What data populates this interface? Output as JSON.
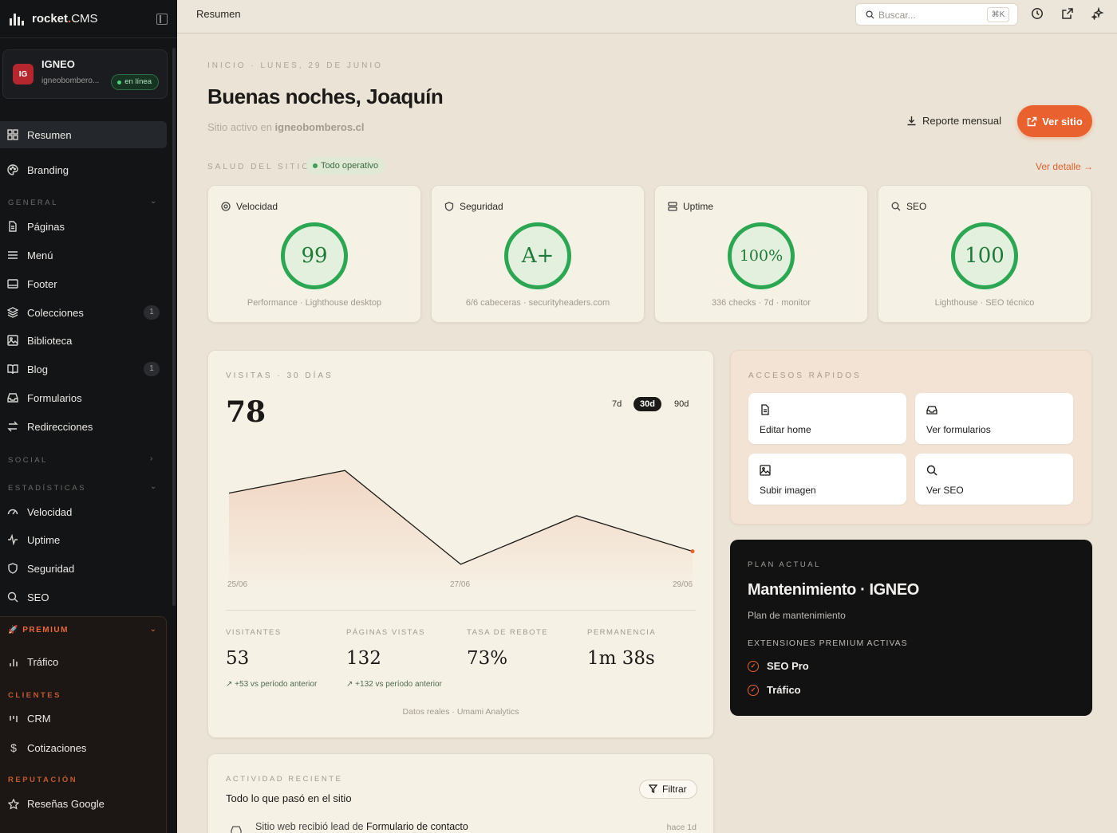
{
  "brand": {
    "name": "rocket",
    "dot": ".",
    "suffix": "CMS"
  },
  "site": {
    "initials": "IG",
    "name": "IGNEO",
    "domain": "igneobombero...",
    "status": "en línea"
  },
  "nav": {
    "summary": "Resumen",
    "branding": "Branding",
    "general_label": "GENERAL",
    "general": [
      {
        "label": "Páginas"
      },
      {
        "label": "Menú"
      },
      {
        "label": "Footer"
      },
      {
        "label": "Colecciones",
        "count": "1"
      },
      {
        "label": "Biblioteca"
      },
      {
        "label": "Blog",
        "count": "1"
      },
      {
        "label": "Formularios"
      },
      {
        "label": "Redirecciones"
      }
    ],
    "social_label": "SOCIAL",
    "stats_label": "ESTADÍSTICAS",
    "stats": [
      "Velocidad",
      "Uptime",
      "Seguridad",
      "SEO"
    ],
    "premium_label": "PREMIUM",
    "premium_item": "Tráfico",
    "clients_label": "CLIENTES",
    "clients": [
      "CRM",
      "Cotizaciones"
    ],
    "reputation_label": "REPUTACIÓN",
    "reputation": [
      "Reseñas Google"
    ]
  },
  "topbar": {
    "breadcrumb": "Resumen",
    "search_placeholder": "Buscar...",
    "shortcut": "⌘K"
  },
  "header": {
    "eyebrow": "INICIO · LUNES, 29 DE JUNIO",
    "greeting": "Buenas noches, Joaquín",
    "subtitle_prefix": "Sitio activo en ",
    "subtitle_domain": "igneobomberos.cl",
    "report_button": "Reporte mensual",
    "site_button": "Ver sitio"
  },
  "health": {
    "label": "SALUD DEL SITIO",
    "badge": "Todo operativo",
    "detail_link": "Ver detalle →",
    "cards": [
      {
        "title": "Velocidad",
        "value": "99",
        "sub": "Performance · Lighthouse desktop",
        "icon": "gauge-icon"
      },
      {
        "title": "Seguridad",
        "value": "A+",
        "sub": "6/6 cabeceras · securityheaders.com",
        "icon": "shield-icon"
      },
      {
        "title": "Uptime",
        "value": "100%",
        "sub": "336 checks · 7d · monitor",
        "icon": "server-icon"
      },
      {
        "title": "SEO",
        "value": "100",
        "sub": "Lighthouse · SEO técnico",
        "icon": "search-icon"
      }
    ]
  },
  "visits": {
    "label": "VISITAS · 30 DÍAS",
    "total": "78",
    "ranges": [
      "7d",
      "30d",
      "90d"
    ],
    "selected_range": "30d",
    "stats": [
      {
        "label": "VISITANTES",
        "value": "53",
        "delta": "+53 vs período anterior"
      },
      {
        "label": "PÁGINAS VISTAS",
        "value": "132",
        "delta": "+132 vs período anterior"
      },
      {
        "label": "TASA DE REBOTE",
        "value": "73%"
      },
      {
        "label": "PERMANENCIA",
        "value": "1m 38s"
      }
    ],
    "footer": "Datos reales · Umami Analytics"
  },
  "chart_data": {
    "type": "area",
    "x_tick_labels": [
      "25/06",
      "27/06",
      "29/06"
    ],
    "values": [
      25,
      32,
      3,
      18,
      7
    ],
    "ylim": [
      0,
      36
    ],
    "grid": false,
    "color": "#1b1a18",
    "fill_color": "#f0cdb8",
    "end_marker_color": "#e8612f"
  },
  "quick": {
    "label": "ACCESOS RÁPIDOS",
    "items": [
      {
        "label": "Editar home",
        "icon": "document-icon"
      },
      {
        "label": "Ver formularios",
        "icon": "inbox-icon"
      },
      {
        "label": "Subir imagen",
        "icon": "image-icon"
      },
      {
        "label": "Ver SEO",
        "icon": "search-icon"
      }
    ]
  },
  "plan": {
    "label": "PLAN ACTUAL",
    "name": "Mantenimiento · IGNEO",
    "desc": "Plan de mantenimiento",
    "ext_label": "EXTENSIONES PREMIUM ACTIVAS",
    "extensions": [
      "SEO Pro",
      "Tráfico"
    ]
  },
  "activity": {
    "label": "ACTIVIDAD RECIENTE",
    "title": "Todo lo que pasó en el sitio",
    "filter": "Filtrar",
    "item": {
      "prefix": "Sitio web recibió lead de ",
      "target": "Formulario de contacto",
      "time": "hace 1d"
    }
  },
  "colors": {
    "accent": "#e8612f",
    "success": "#2ba653",
    "sidebar": "#131416"
  }
}
